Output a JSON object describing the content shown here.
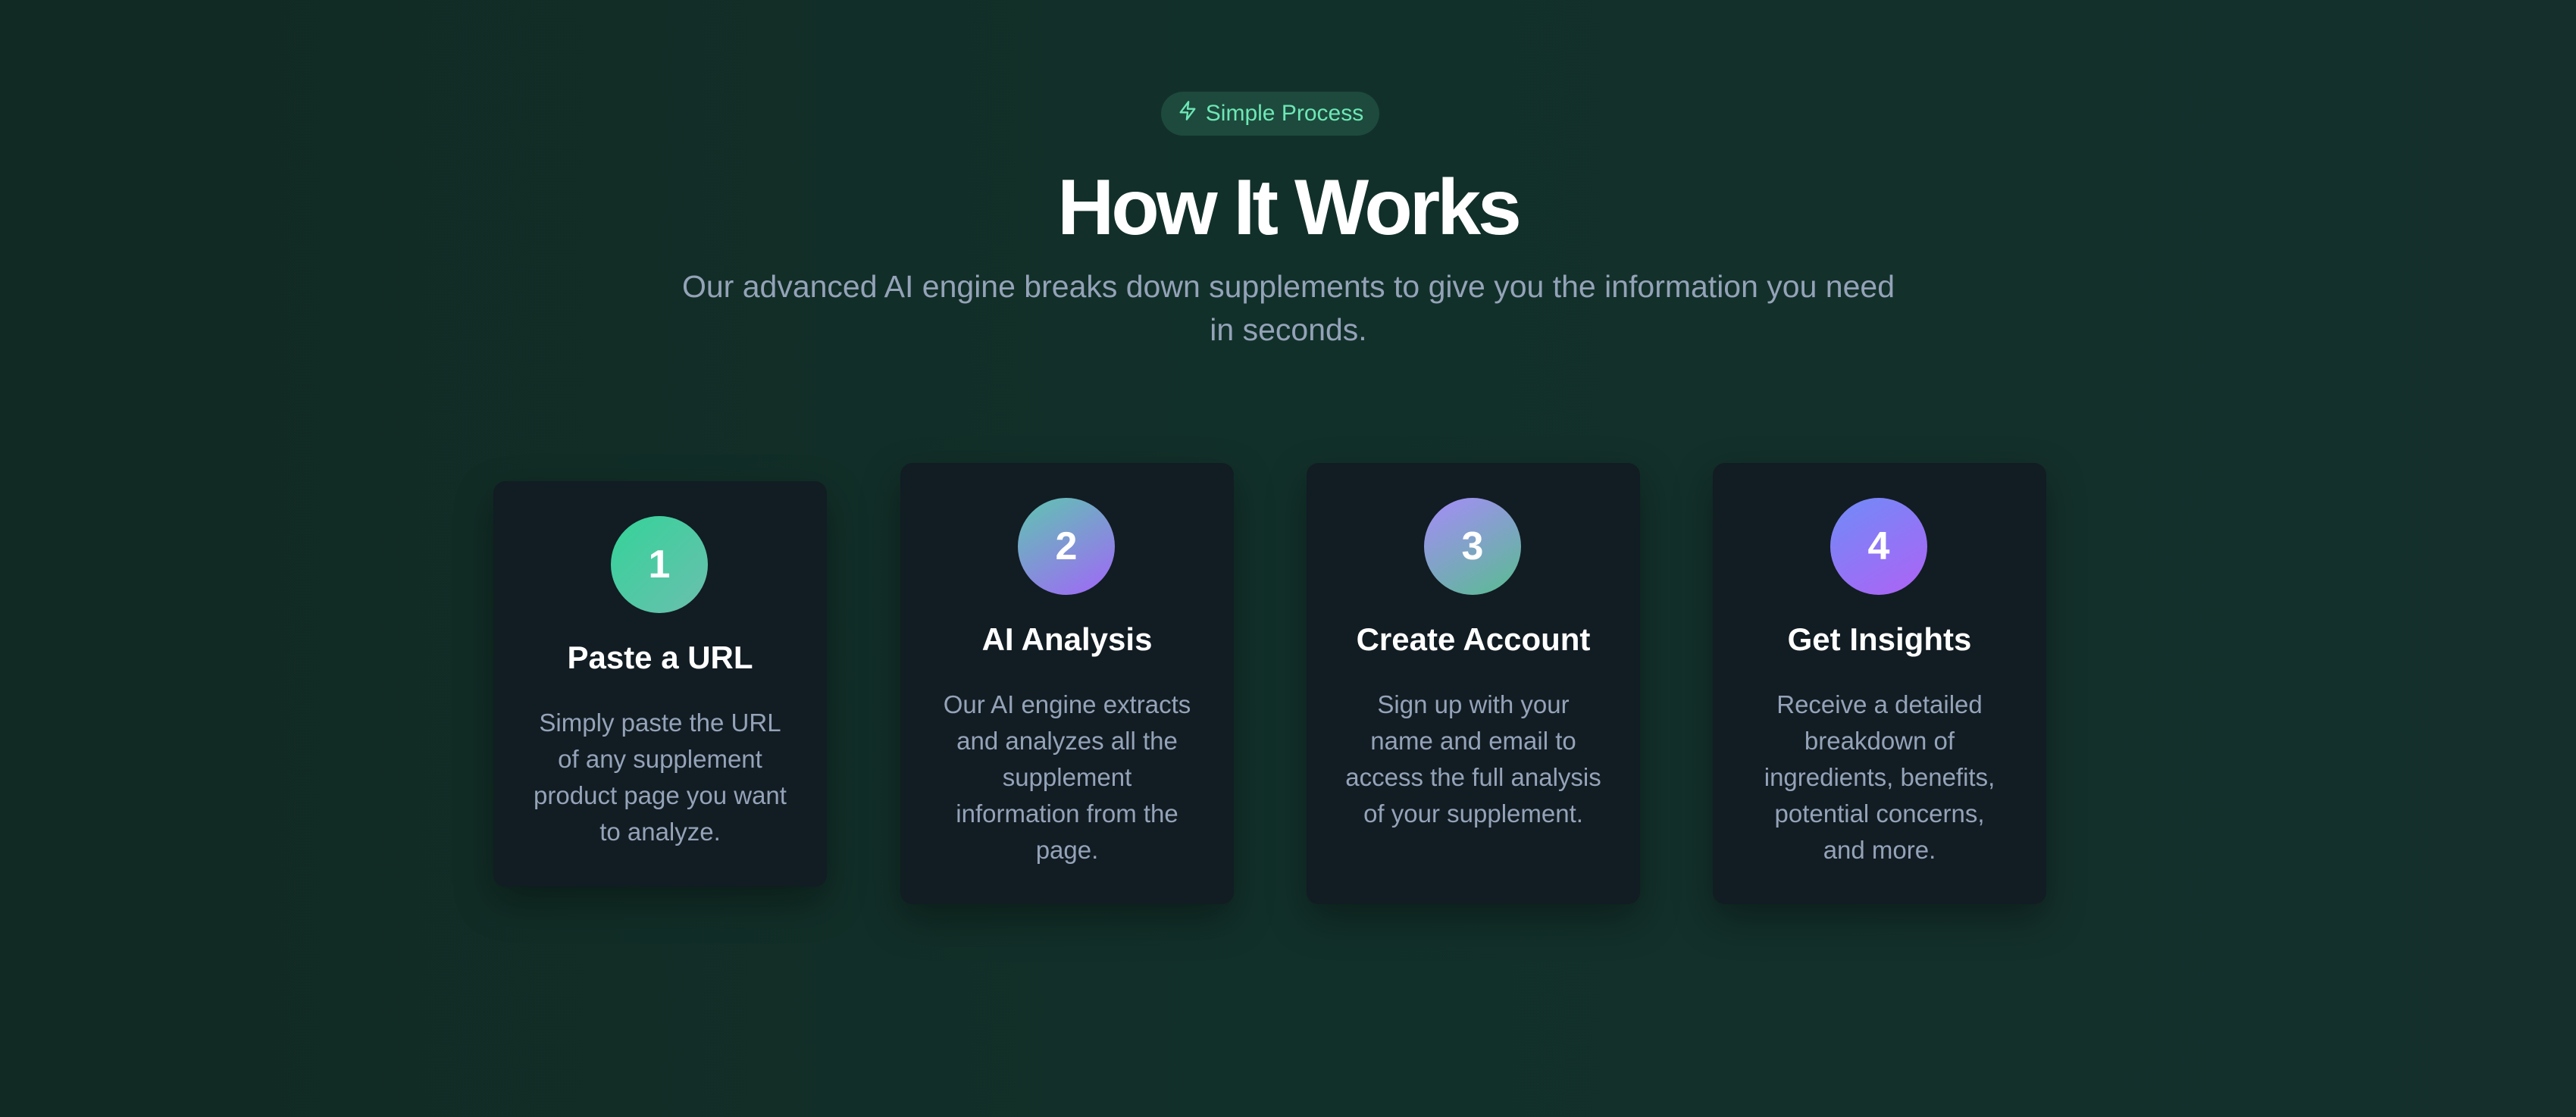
{
  "badge": {
    "label": "Simple Process",
    "icon": "lightning-bolt-icon"
  },
  "title": "How It Works",
  "subtitle": "Our advanced AI engine breaks down supplements to give you the information you need in seconds.",
  "steps": [
    {
      "number": "1",
      "title": "Paste a URL",
      "description": "Simply paste the URL of any supplement product page you want to analyze."
    },
    {
      "number": "2",
      "title": "AI Analysis",
      "description": "Our AI engine extracts and analyzes all the supplement information from the page."
    },
    {
      "number": "3",
      "title": "Create Account",
      "description": "Sign up with your name and email to access the full analysis of your supplement."
    },
    {
      "number": "4",
      "title": "Get Insights",
      "description": "Receive a detailed breakdown of ingredients, benefits, potential concerns, and more."
    }
  ],
  "colors": {
    "accent": "#6ee7b7",
    "background": "#112a23",
    "card": "#121c23",
    "step1": [
      "#34d399",
      "#5fbfa3"
    ],
    "step2": [
      "#5ec6b0",
      "#9b6ff2"
    ],
    "step3": [
      "#a78bfa",
      "#5fb89a"
    ],
    "step4": [
      "#6f8cf7",
      "#a866f5"
    ]
  }
}
